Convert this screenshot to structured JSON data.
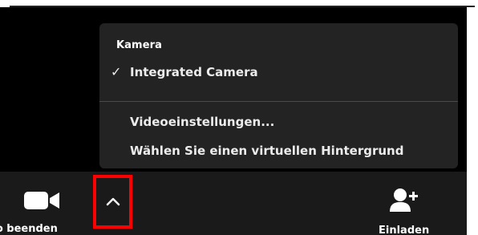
{
  "menu": {
    "heading": "Kamera",
    "items": [
      {
        "label": "Integrated Camera",
        "checked": true,
        "check_glyph": "✓"
      },
      {
        "label": "Videoeinstellungen..."
      },
      {
        "label": "Wählen Sie einen virtuellen Hintergrund"
      }
    ]
  },
  "toolbar": {
    "video_label": "eo beenden",
    "invite_label": "Einladen",
    "video_icon": "video-camera-icon",
    "caret_icon": "chevron-up-icon",
    "invite_icon": "add-user-icon"
  },
  "colors": {
    "background": "#000000",
    "menu": "#232323",
    "toolbar": "#1a1a1a",
    "highlight": "#ff0000",
    "text": "#ffffff"
  }
}
